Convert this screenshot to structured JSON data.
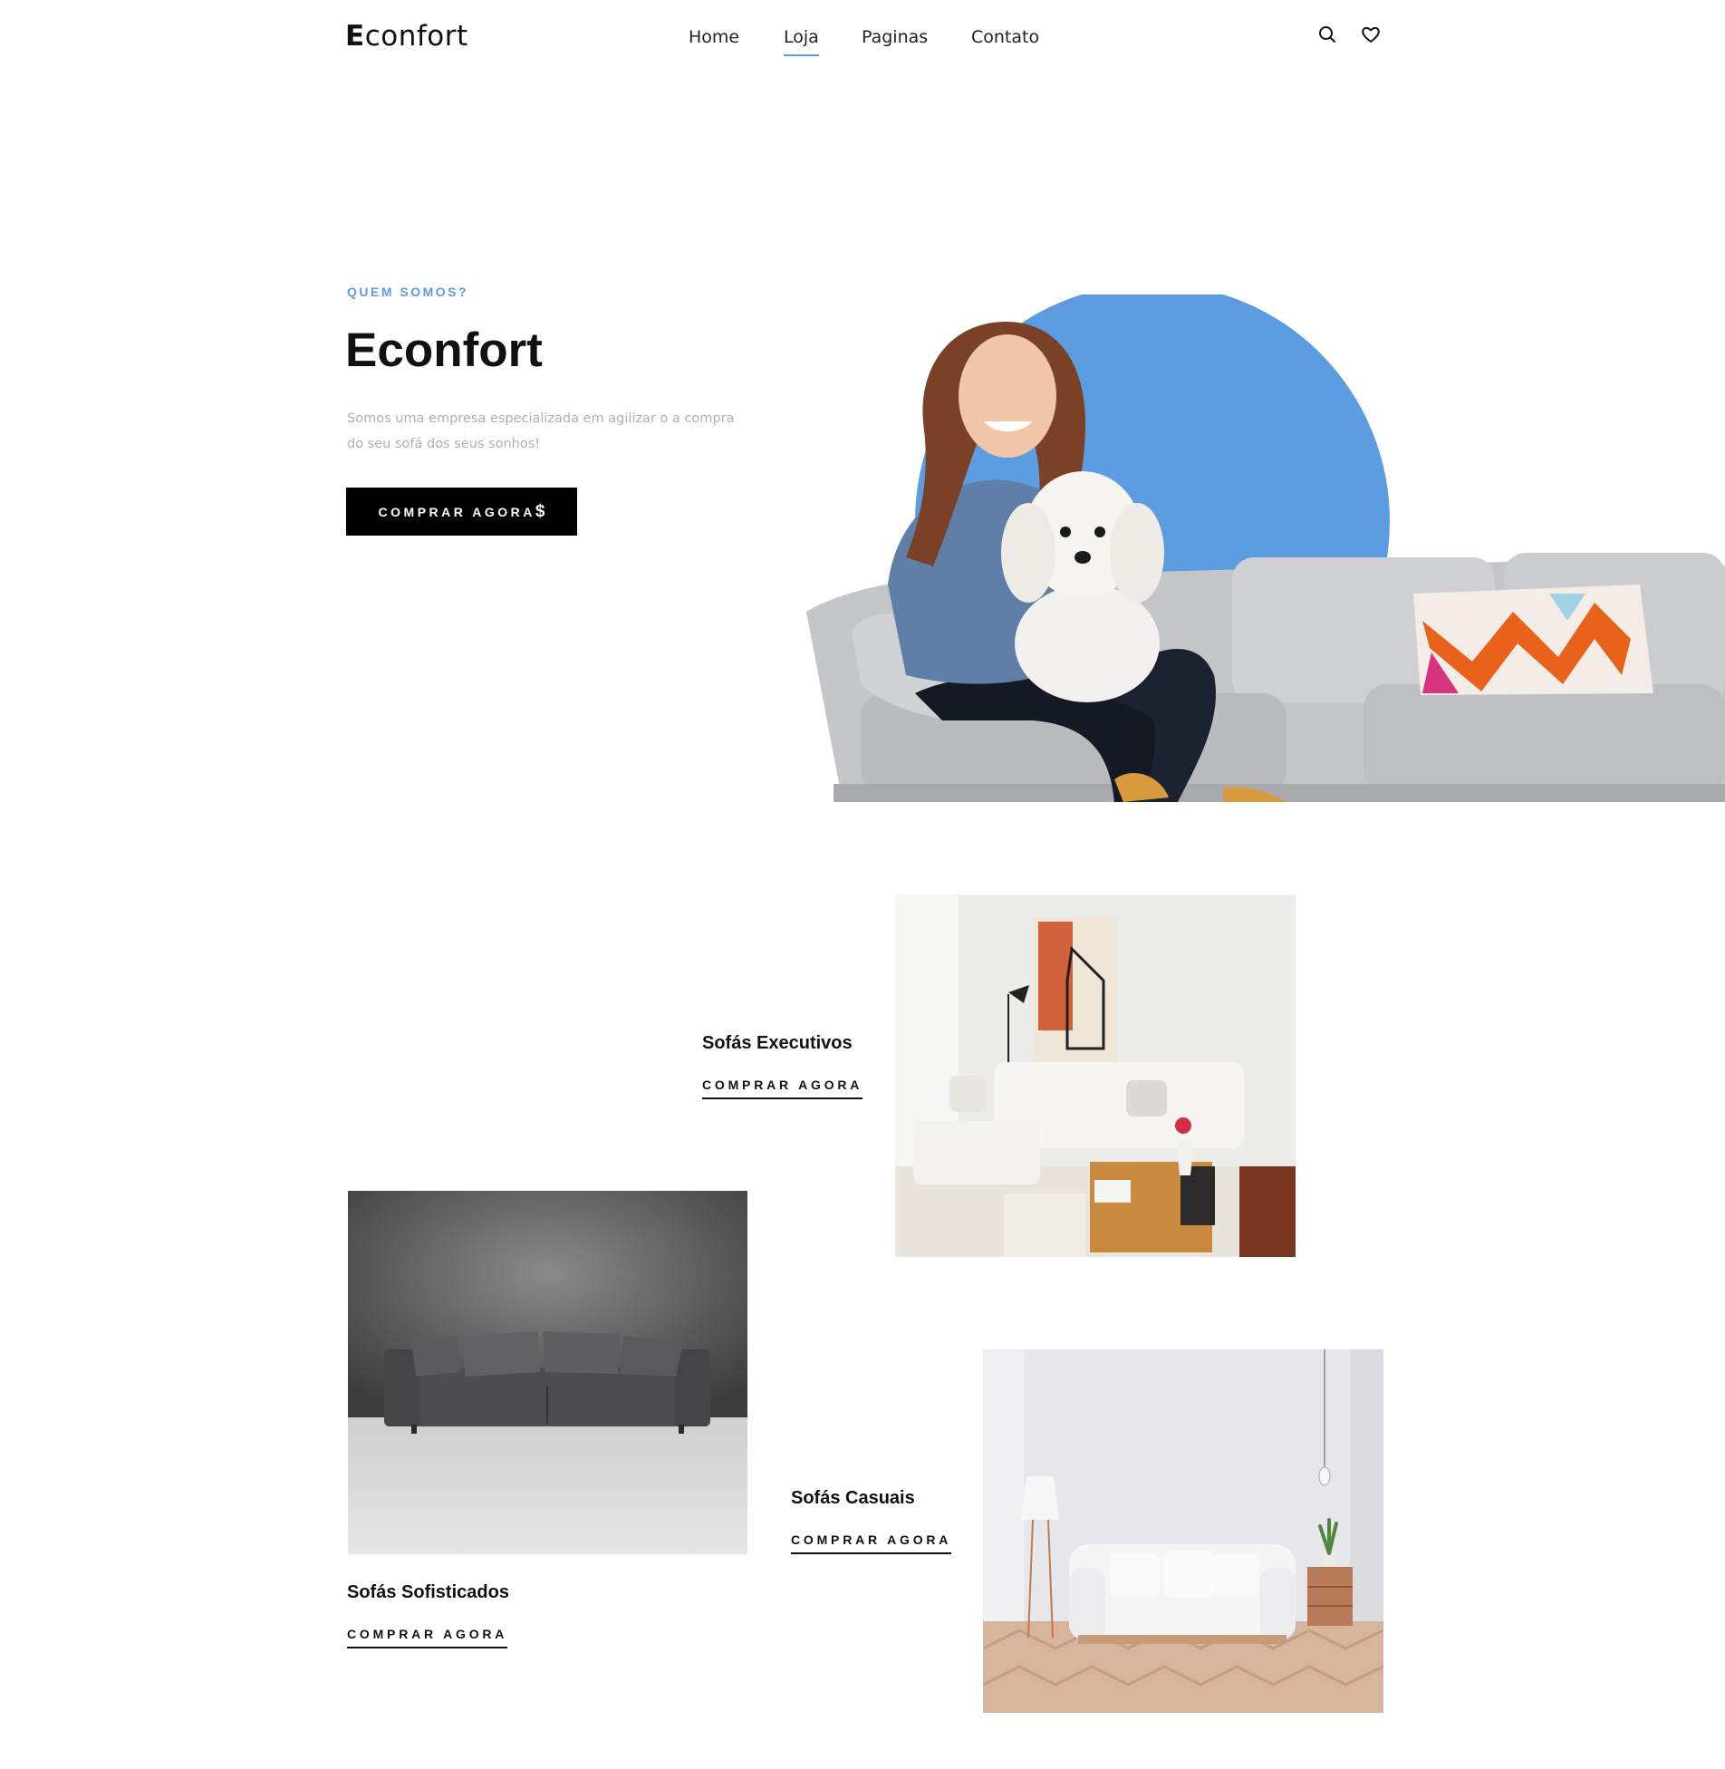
{
  "header": {
    "logo_first": "E",
    "logo_rest": "confort",
    "nav": [
      {
        "label": "Home",
        "active": false
      },
      {
        "label": "Loja",
        "active": true
      },
      {
        "label": "Paginas",
        "active": false
      },
      {
        "label": "Contato",
        "active": false
      }
    ],
    "icons": [
      "search-icon",
      "heart-icon"
    ]
  },
  "hero": {
    "eyebrow": "QUEM SOMOS?",
    "title": "Econfort",
    "description": "Somos uma empresa especializada em agilizar o a compra do seu sofá dos seus sonhos!",
    "button_label": "COMPRAR AGORA",
    "button_symbol": "$"
  },
  "categories": [
    {
      "title": "Sofás Executivos",
      "link": "COMPRAR AGORA"
    },
    {
      "title": "Sofás Sofisticados",
      "link": "COMPRAR AGORA"
    },
    {
      "title": "Sofás Casuais",
      "link": "COMPRAR AGORA"
    }
  ],
  "colors": {
    "accent": "#5b9de0",
    "button_bg": "#000000",
    "text": "#111111",
    "muted_text": "#b0b0b0"
  }
}
